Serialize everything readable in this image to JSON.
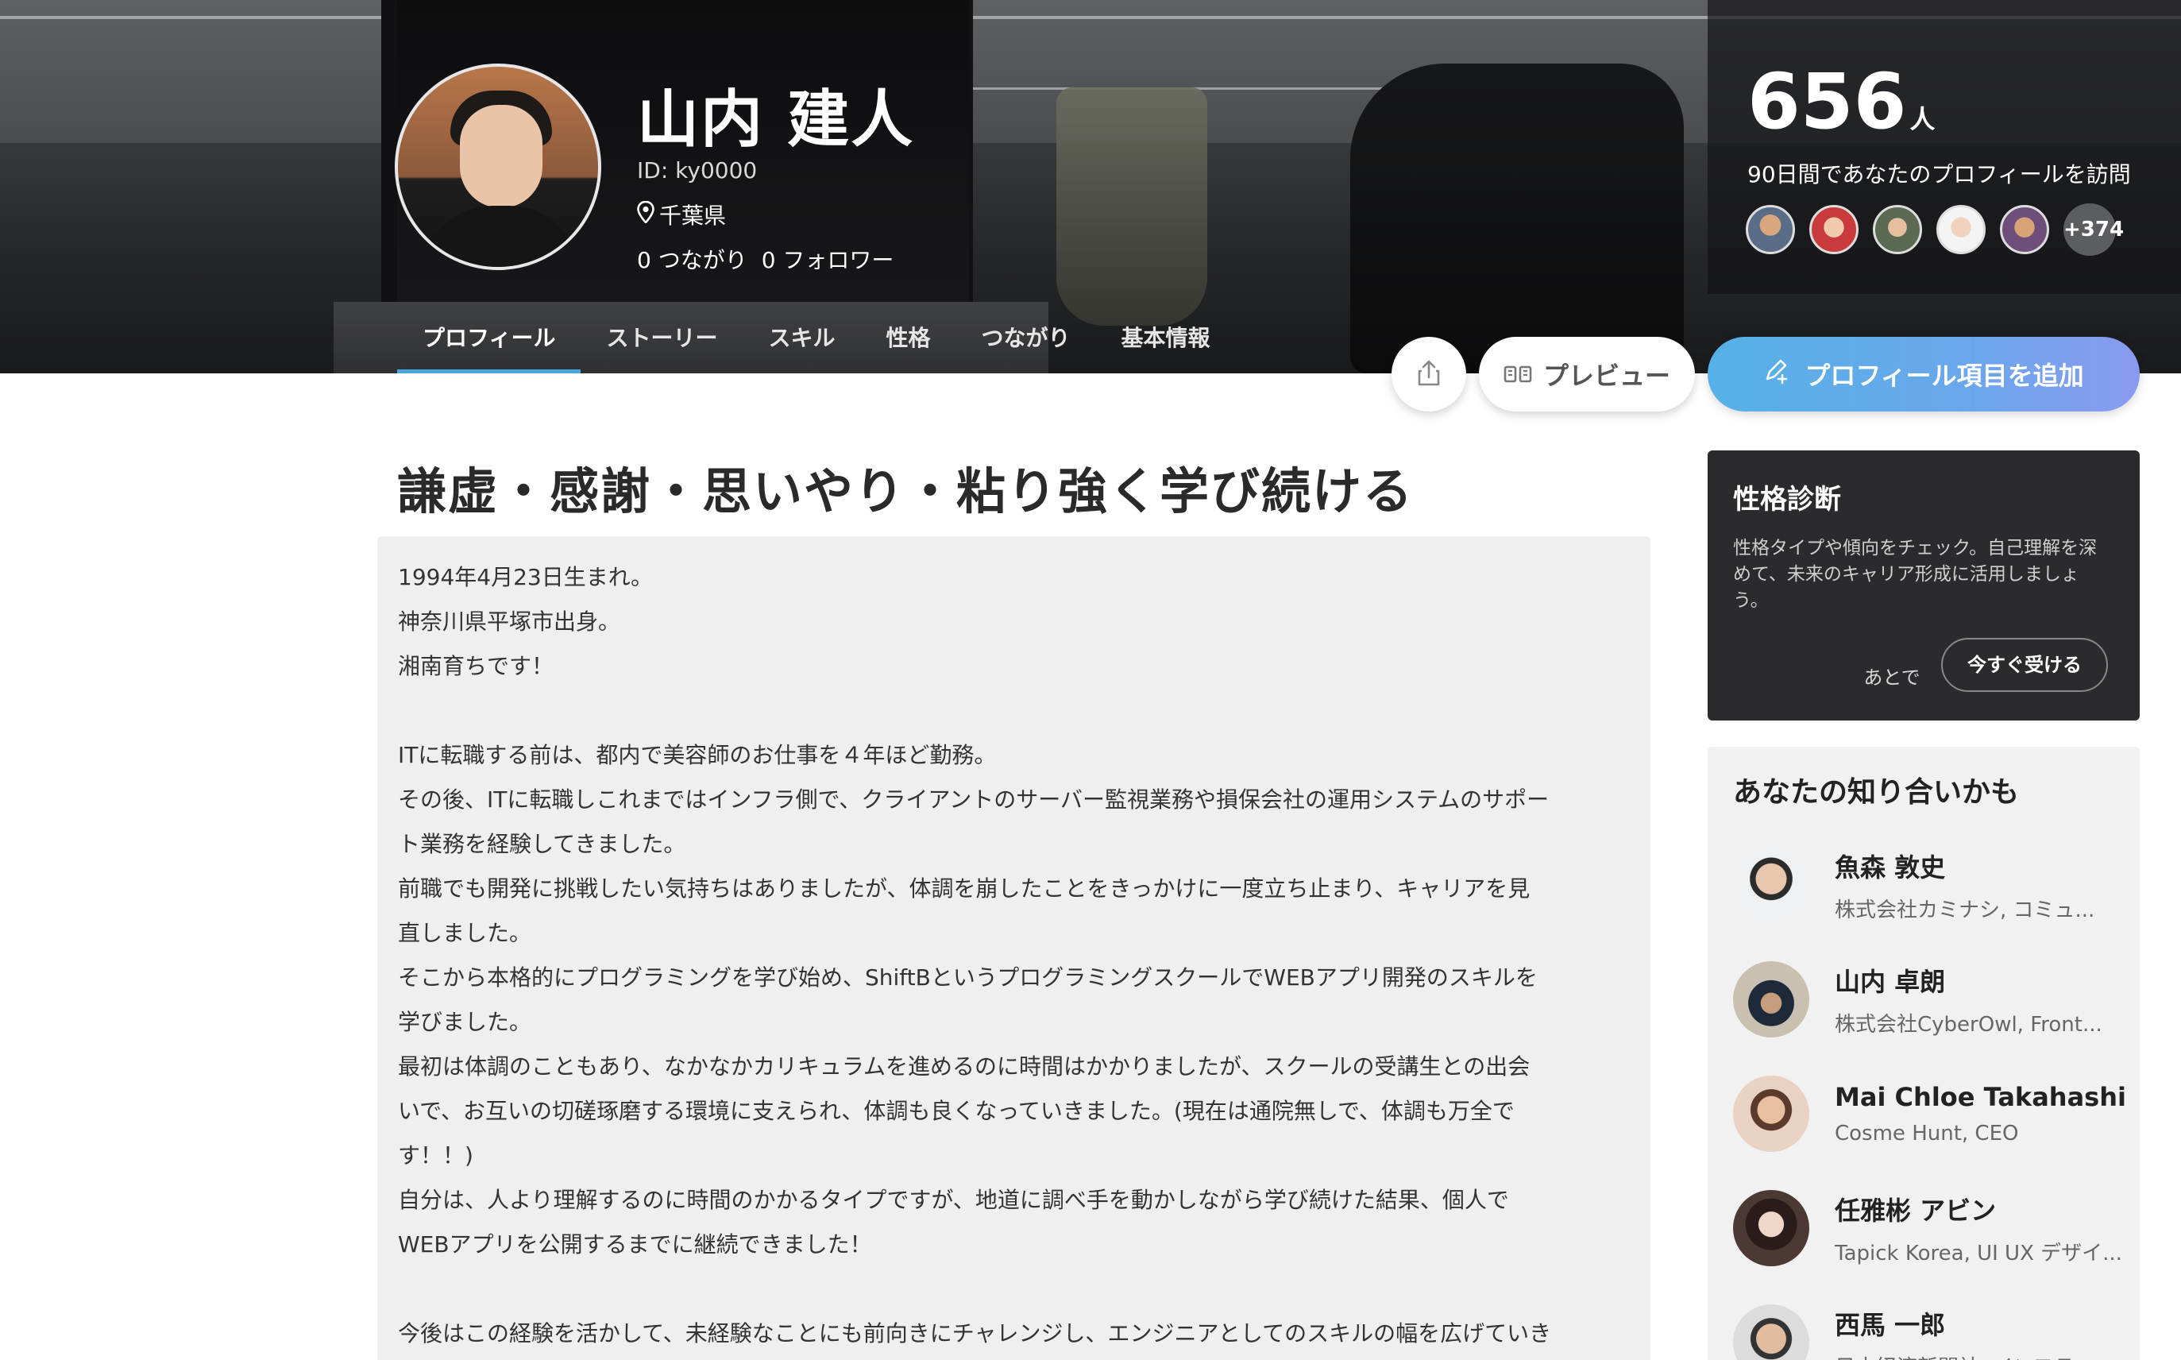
{
  "profile": {
    "name": "山内 建人",
    "id_label": "ID: ky0000",
    "prefecture": "千葉県",
    "connections": "0 つながり",
    "followers": "0 フォロワー"
  },
  "tabs": [
    {
      "label": "プロフィール",
      "active": true
    },
    {
      "label": "ストーリー"
    },
    {
      "label": "スキル"
    },
    {
      "label": "性格"
    },
    {
      "label": "つながり"
    },
    {
      "label": "基本情報"
    }
  ],
  "visitors": {
    "count": "656",
    "unit": "人",
    "description": "90日間であなたのプロフィールを訪問",
    "more": "+374"
  },
  "actions": {
    "preview": "プレビュー",
    "add_item": "プロフィール項目を追加"
  },
  "headline": "謙虚・感謝・思いやり・粘り強く学び続ける",
  "bio_lines": [
    "1994年4月23日生まれ。",
    "神奈川県平塚市出身。",
    "湘南育ちです！",
    "",
    "ITに転職する前は、都内で美容師のお仕事を４年ほど勤務。",
    "その後、ITに転職しこれまではインフラ側で、クライアントのサーバー監視業務や損保会社の運用システムのサポー",
    "ト業務を経験してきました。",
    "前職でも開発に挑戦したい気持ちはありましたが、体調を崩したことをきっかけに一度立ち止まり、キャリアを見",
    "直しました。",
    "そこから本格的にプログラミングを学び始め、ShiftBというプログラミングスクールでWEBアプリ開発のスキルを",
    "学びました。",
    "最初は体調のこともあり、なかなかカリキュラムを進めるのに時間はかかりましたが、スクールの受講生との出会",
    "いで、お互いの切磋琢磨する環境に支えられ、体調も良くなっていきました。(現在は通院無しで、体調も万全で",
    "す！！)",
    "自分は、人より理解するのに時間のかかるタイプですが、地道に調べ手を動かしながら学び続けた結果、個人で",
    "WEBアプリを公開するまでに継続できました！",
    "",
    "今後はこの経験を活かして、未経験なことにも前向きにチャレンジし、エンジニアとしてのスキルの幅を広げていき"
  ],
  "personality": {
    "title": "性格診断",
    "description": "性格タイプや傾向をチェック。自己理解を深めて、未来のキャリア形成に活用しましょう。",
    "later": "あとで",
    "take_now": "今すぐ受ける"
  },
  "suggestions": {
    "title": "あなたの知り合いかも",
    "people": [
      {
        "name": "魚森 敦史",
        "role": "株式会社カミナシ, コミュ..."
      },
      {
        "name": "山内 卓朗",
        "role": "株式会社CyberOwl, Front..."
      },
      {
        "name": "Mai Chloe Takahashi",
        "role": "Cosme Hunt, CEO"
      },
      {
        "name": "任雅彬 アビン",
        "role": "Tapick Korea, UI UX デザイ..."
      },
      {
        "name": "西馬 一郎",
        "role": "日本経済新聞社, インフラ..."
      }
    ]
  },
  "colors": {
    "accent": "#4aa6d8",
    "add_button_from": "#55b1e6",
    "add_button_to": "#8a9af0",
    "dark_card": "#2b2b2d"
  },
  "icons": {
    "location": "location-pin-icon",
    "share": "share-icon",
    "preview": "preview-icon",
    "add": "pencil-plus-icon"
  }
}
